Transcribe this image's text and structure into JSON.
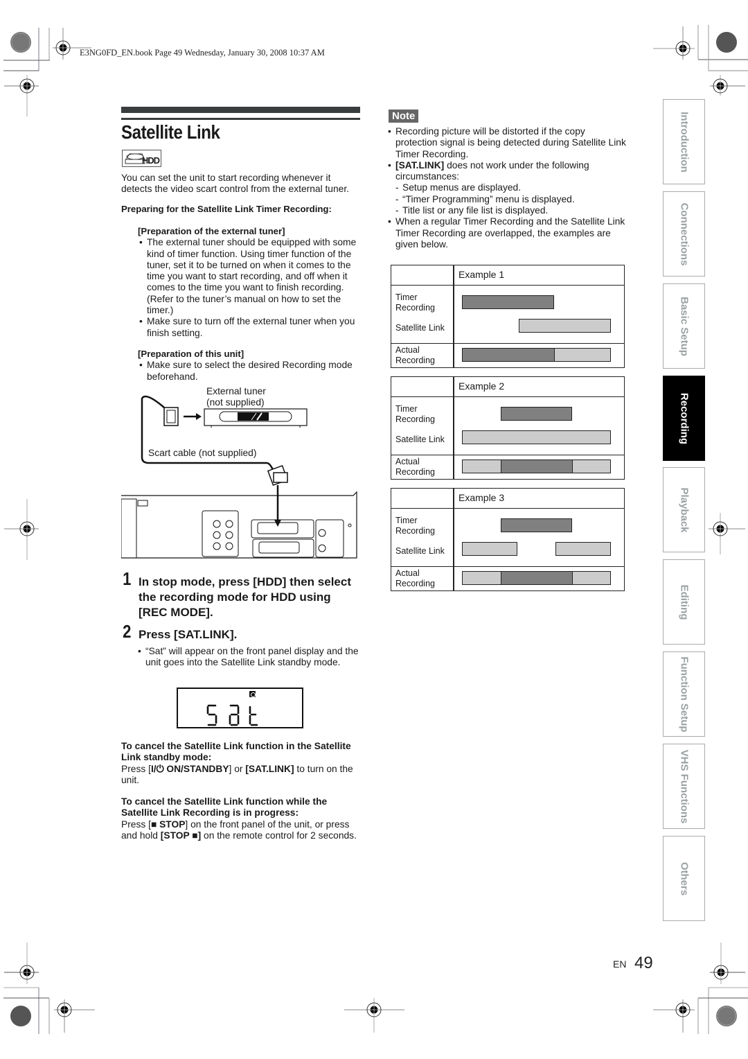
{
  "print_header": "E3NG0FD_EN.book  Page 49  Wednesday, January 30, 2008  10:37 AM",
  "section": {
    "title": "Satellite Link",
    "badge_label": "HDD",
    "intro": "You can set the unit to start recording whenever it detects the video scart control from the external tuner.",
    "prep_heading": "Preparing for the Satellite Link Timer Recording:",
    "prep_tuner": {
      "heading": "[Preparation of the external tuner]",
      "bullets": [
        "The external tuner should be equipped with some kind of timer function. Using timer function of the tuner, set it to be turned on when it comes to the time you want to start recording, and off when it comes to the time you want to finish recording. (Refer to the tuner’s manual on how to set the timer.)",
        "Make sure to turn off the external tuner when you finish setting."
      ]
    },
    "prep_unit": {
      "heading": "[Preparation of this unit]",
      "bullets": [
        "Make sure to select the desired Recording mode beforehand."
      ]
    },
    "diagram": {
      "tuner_label_1": "External tuner",
      "tuner_label_2": "(not supplied)",
      "cable_label": "Scart cable (not supplied)"
    },
    "steps": [
      {
        "num": "1",
        "text": "In stop mode, press [HDD] then select the recording mode for HDD using [REC MODE]."
      },
      {
        "num": "2",
        "text": "Press [SAT.LINK].",
        "bullet": "“Sat” will appear on the front panel display and the unit goes into the Satellite Link standby mode."
      }
    ],
    "lcd_text": "Sat",
    "cancel_standby": {
      "heading": "To cancel the Satellite Link function in the Satellite Link standby mode:",
      "text_pre": "Press [",
      "key1": "I/⏻ ON/STANDBY",
      "text_mid": "] or ",
      "key2": "[SAT.LINK]",
      "text_post": " to turn on the unit."
    },
    "cancel_progress": {
      "heading": "To cancel the Satellite Link function while the Satellite Link Recording is in progress:",
      "text_pre": "Press [",
      "key1": "■ STOP",
      "text_mid": "] on the front panel of the unit, or press and hold ",
      "key2": "[STOP ■]",
      "text_post": " on the remote control for 2 seconds."
    }
  },
  "note": {
    "label": "Note",
    "bullet1": "Recording picture will be distorted if the copy protection signal is being detected during Satellite Link Timer Recording.",
    "bullet2_key": "[SAT.LINK]",
    "bullet2_text": " does not work under the following circumstances:",
    "dashes": [
      "Setup menus are displayed.",
      "“Timer Programming” menu is displayed.",
      "Title list or any file list is displayed."
    ],
    "bullet3": "When a regular Timer Recording and the Satellite Link Timer Recording are overlapped, the examples are given below."
  },
  "examples": {
    "row_labels": {
      "timer": "Timer Recording",
      "satellite": "Satellite Link",
      "actual": "Actual Recording"
    },
    "items": [
      {
        "title": "Example 1",
        "timer": [
          [
            0.0,
            0.62
          ]
        ],
        "satellite": [
          [
            0.38,
            1.0
          ]
        ],
        "actual": [
          {
            "from": 0.0,
            "to": 0.62,
            "kind": "timer"
          },
          {
            "from": 0.62,
            "to": 1.0,
            "kind": "satellite"
          }
        ]
      },
      {
        "title": "Example 2",
        "timer": [
          [
            0.26,
            0.74
          ]
        ],
        "satellite": [
          [
            0.0,
            1.0
          ]
        ],
        "actual": [
          {
            "from": 0.0,
            "to": 0.26,
            "kind": "satellite"
          },
          {
            "from": 0.26,
            "to": 0.74,
            "kind": "timer"
          },
          {
            "from": 0.74,
            "to": 1.0,
            "kind": "satellite"
          }
        ]
      },
      {
        "title": "Example 3",
        "timer": [
          [
            0.26,
            0.74
          ]
        ],
        "satellite": [
          [
            0.0,
            0.37
          ],
          [
            0.63,
            1.0
          ]
        ],
        "actual": [
          {
            "from": 0.0,
            "to": 0.26,
            "kind": "satellite"
          },
          {
            "from": 0.26,
            "to": 0.74,
            "kind": "timer"
          },
          {
            "from": 0.74,
            "to": 1.0,
            "kind": "satellite"
          }
        ]
      }
    ]
  },
  "side_tabs": [
    {
      "label": "Introduction",
      "active": false
    },
    {
      "label": "Connections",
      "active": false
    },
    {
      "label": "Basic Setup",
      "active": false
    },
    {
      "label": "Recording",
      "active": true
    },
    {
      "label": "Playback",
      "active": false
    },
    {
      "label": "Editing",
      "active": false
    },
    {
      "label": "Function Setup",
      "active": false
    },
    {
      "label": "VHS Functions",
      "active": false
    },
    {
      "label": "Others",
      "active": false
    }
  ],
  "footer": {
    "lang": "EN",
    "page": "49"
  },
  "colors": {
    "timer_bar": "#808080",
    "satellite_bar": "#cccccc",
    "active_tab": "#000000",
    "inactive_tab_text": "#9aa1a3",
    "title_bar": "#3a3d3e"
  }
}
